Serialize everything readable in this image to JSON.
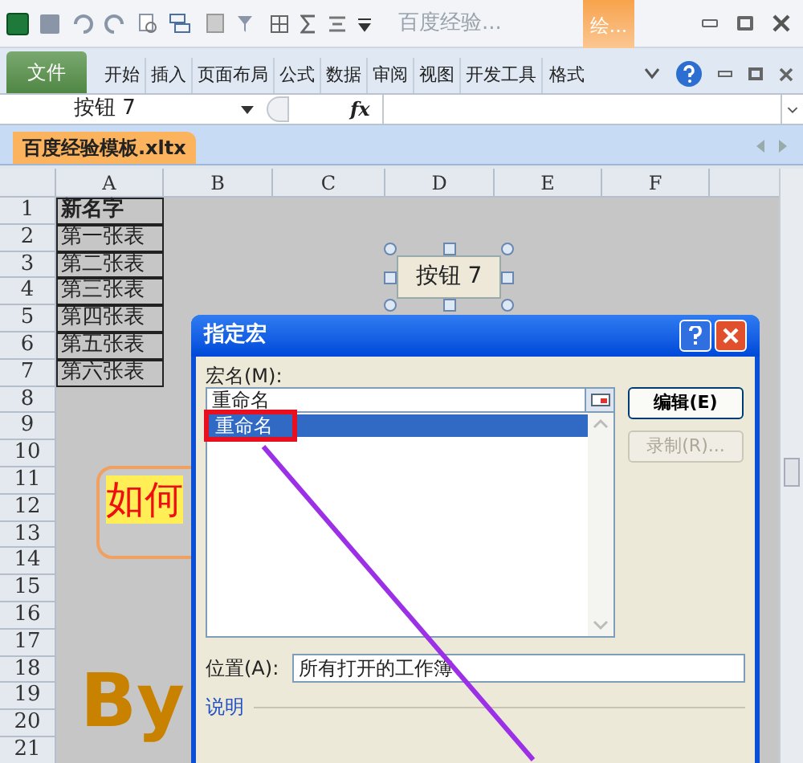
{
  "title_bar": {
    "document": "百度经验...",
    "context_tab": "绘..."
  },
  "ribbon_tabs": [
    {
      "label": "文件",
      "kind": "file"
    },
    {
      "label": "开始",
      "kind": "tab"
    },
    {
      "label": "插入",
      "kind": "tab"
    },
    {
      "label": "页面布局",
      "kind": "tab"
    },
    {
      "label": "公式",
      "kind": "tab"
    },
    {
      "label": "数据",
      "kind": "tab"
    },
    {
      "label": "审阅",
      "kind": "tab"
    },
    {
      "label": "视图",
      "kind": "tab"
    },
    {
      "label": "开发工具",
      "kind": "tab"
    },
    {
      "label": "格式",
      "kind": "context"
    }
  ],
  "formula_bar": {
    "name_box": "按钮 7",
    "fx": "fx"
  },
  "workbook_tab": "百度经验模板.xltx",
  "sheet": {
    "columns": [
      "A",
      "B",
      "C",
      "D",
      "E",
      "F"
    ],
    "rows": [
      {
        "number": "1",
        "a": "新名字",
        "header": true
      },
      {
        "number": "2",
        "a": "第一张表",
        "header": false
      },
      {
        "number": "3",
        "a": "第二张表",
        "header": false
      },
      {
        "number": "4",
        "a": "第三张表",
        "header": false
      },
      {
        "number": "5",
        "a": "第四张表",
        "header": false
      },
      {
        "number": "6",
        "a": "第五张表",
        "header": false
      },
      {
        "number": "7",
        "a": "第六张表",
        "header": false
      },
      {
        "number": "8"
      },
      {
        "number": "9"
      },
      {
        "number": "10"
      },
      {
        "number": "11"
      },
      {
        "number": "12"
      },
      {
        "number": "13"
      },
      {
        "number": "14"
      },
      {
        "number": "15"
      },
      {
        "number": "16"
      },
      {
        "number": "17"
      },
      {
        "number": "18"
      },
      {
        "number": "19"
      },
      {
        "number": "20"
      },
      {
        "number": "21"
      }
    ]
  },
  "shapes": {
    "button": "按钮 7",
    "wordart_1": "如何",
    "wordart_2": "By"
  },
  "dialog": {
    "title": "指定宏",
    "name_label": "宏名(M):",
    "name_value": "重命名",
    "macros": [
      {
        "label": "重命名",
        "selected": true
      }
    ],
    "buttons": [
      {
        "label": "编辑(E)",
        "disabled": false
      },
      {
        "label": "录制(R)...",
        "disabled": true
      }
    ],
    "location_label": "位置(A):",
    "location_value": "所有打开的工作簿",
    "description_label": "说明"
  }
}
